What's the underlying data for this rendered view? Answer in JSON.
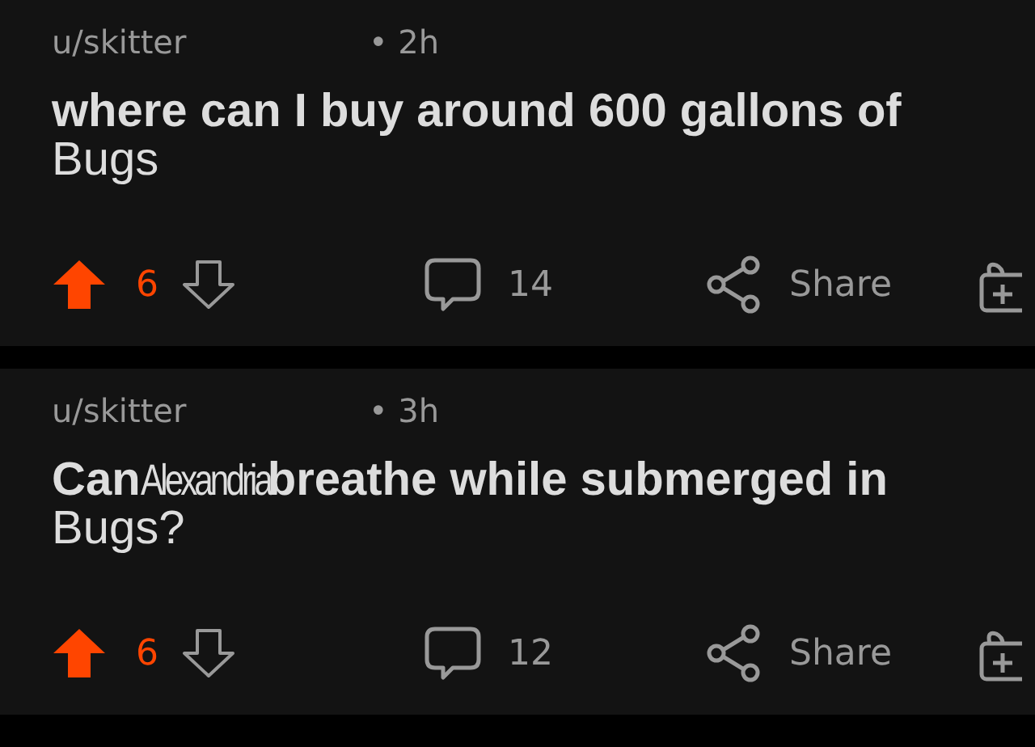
{
  "posts": [
    {
      "author": "u/skitter",
      "time": "• 2h",
      "title_parts": [
        {
          "text": "where can I buy around 600 gallons of",
          "kind": "bold"
        },
        {
          "text": "Bugs",
          "kind": "light"
        }
      ],
      "upvoted": true,
      "score": "6",
      "comments": "14",
      "share": "Share"
    },
    {
      "author": "u/skitter",
      "time": "• 3h",
      "title_parts": [
        {
          "text": "Can",
          "kind": "bold"
        },
        {
          "text": "Alexandria",
          "kind": "condensed"
        },
        {
          "text": "breathe while submerged in",
          "kind": "bold"
        },
        {
          "text": "Bugs?",
          "kind": "light"
        }
      ],
      "upvoted": true,
      "score": "6",
      "comments": "12",
      "share": "Share"
    }
  ]
}
